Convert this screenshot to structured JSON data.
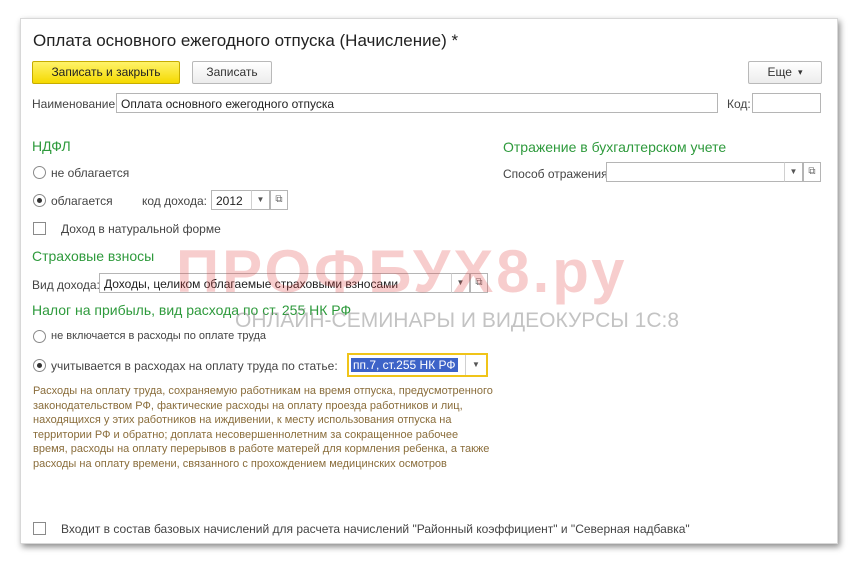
{
  "window": {
    "title": "Оплата основного ежегодного отпуска (Начисление) *"
  },
  "toolbar": {
    "save_close_label": "Записать и закрыть",
    "save_label": "Записать",
    "more_label": "Еще"
  },
  "name_field": {
    "label": "Наименование:",
    "value": "Оплата основного ежегодного отпуска"
  },
  "code_field": {
    "label": "Код:",
    "value": ""
  },
  "ndfl": {
    "title": "НДФЛ",
    "not_taxed_label": "не облагается",
    "taxed_label": "облагается",
    "selected": "taxed",
    "income_code_label": "код дохода:",
    "income_code_value": "2012",
    "in_kind_label": "Доход в натуральной форме",
    "in_kind_checked": false
  },
  "accounting": {
    "title": "Отражение в бухгалтерском учете",
    "method_label": "Способ отражения:",
    "method_value": ""
  },
  "insurance": {
    "title": "Страховые взносы",
    "income_type_label": "Вид дохода:",
    "income_type_value": "Доходы, целиком облагаемые страховыми взносами"
  },
  "profit_tax": {
    "title": "Налог на прибыль, вид расхода по ст. 255 НК РФ",
    "not_included_label": "не включается в расходы по оплате труда",
    "included_label": "учитывается в расходах на оплату труда по статье:",
    "selected": "included",
    "article_value": "пп.7, ст.255 НК РФ",
    "description": "Расходы на оплату труда, сохраняемую работникам на время отпуска, предусмотренного законодательством РФ, фактические расходы на оплату проезда работников и лиц, находящихся у этих работников на иждивении, к месту использования отпуска на территории РФ и обратно; доплата несовершеннолетним за сокращенное рабочее время, расходы на оплату перерывов в работе матерей для кормления ребенка, а также расходы на оплату времени, связанного с прохождением медицинских осмотров"
  },
  "base_accruals": {
    "label": "Входит в состав базовых начислений для расчета начислений \"Районный коэффициент\" и \"Северная надбавка\"",
    "checked": false
  },
  "watermark": {
    "brand": "ПРОФБУХ8.ру",
    "tagline": "ОНЛАЙН-СЕМИНАРЫ И ВИДЕОКУРСЫ 1С:8"
  },
  "colors": {
    "section_title": "#2e9a3c",
    "primary_button": "#f5d900",
    "description_text": "#8a6d3b",
    "selection": "#3d63c8",
    "watermark": "#e23b3b"
  }
}
